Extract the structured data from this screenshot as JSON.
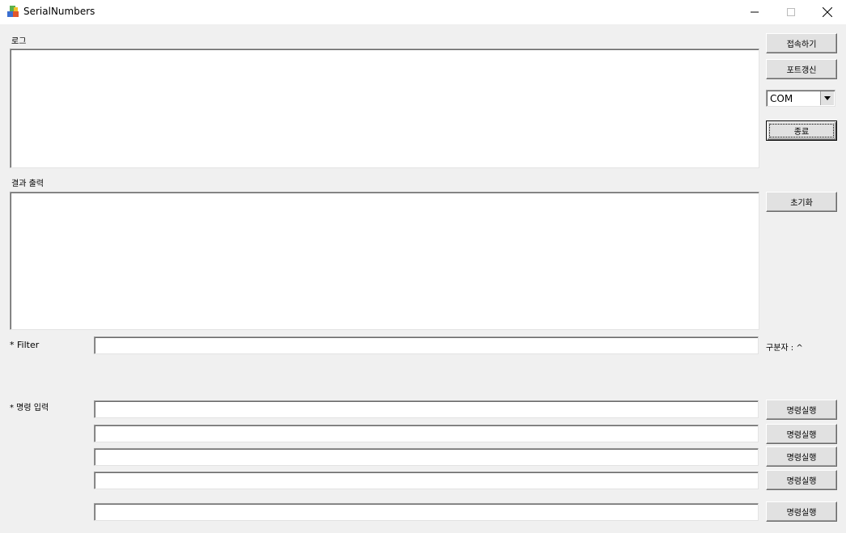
{
  "window": {
    "title": "SerialNumbers",
    "icon": "app-cube-icon",
    "controls": [
      "minimize-icon",
      "maximize-icon",
      "close-icon"
    ]
  },
  "log_section": {
    "label": "로그",
    "content": ""
  },
  "result_section": {
    "label": "결과 출력",
    "content": ""
  },
  "buttons": {
    "connect": "접속하기",
    "port_refresh": "포트갱신",
    "exit": "종료",
    "reset": "초기화"
  },
  "port_combo": {
    "selected": "COM"
  },
  "filter": {
    "label": "* Filter",
    "value": "",
    "separator_text": "구분자 : ^"
  },
  "command": {
    "label": "* 명령 입력",
    "rows": [
      {
        "value": "",
        "button": "명령실행"
      },
      {
        "value": "",
        "button": "명령실행"
      },
      {
        "value": "",
        "button": "명령실행"
      },
      {
        "value": "",
        "button": "명령실행"
      },
      {
        "value": "",
        "button": "명령실행"
      }
    ]
  }
}
